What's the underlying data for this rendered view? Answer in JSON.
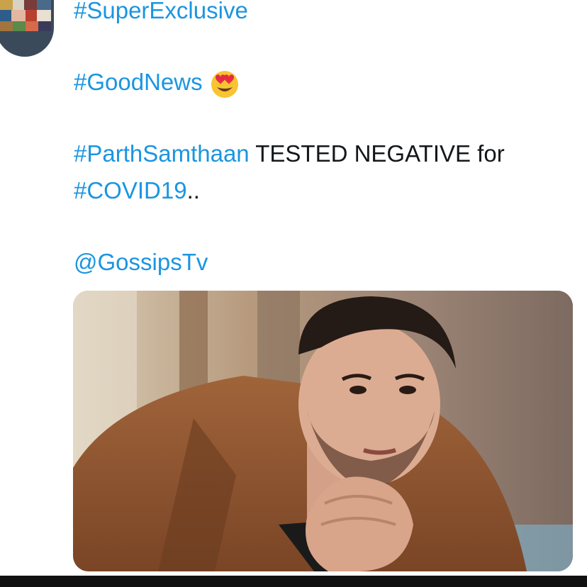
{
  "tweet": {
    "hashtag_super_exclusive": "#SuperExclusive",
    "hashtag_good_news": "#GoodNews",
    "emoji": "heart-eyes-emoji",
    "hashtag_parth": "#ParthSamthaan",
    "tested_text": " TESTED NEGATIVE for",
    "hashtag_covid": "#COVID19",
    "trailing_dots": "..",
    "mention": "@GossipsTv"
  },
  "colors": {
    "link": "#1b95e0",
    "text": "#14171a",
    "bottom_bar": "#111111"
  },
  "media": {
    "subject": "man-in-brown-coat-photo"
  }
}
